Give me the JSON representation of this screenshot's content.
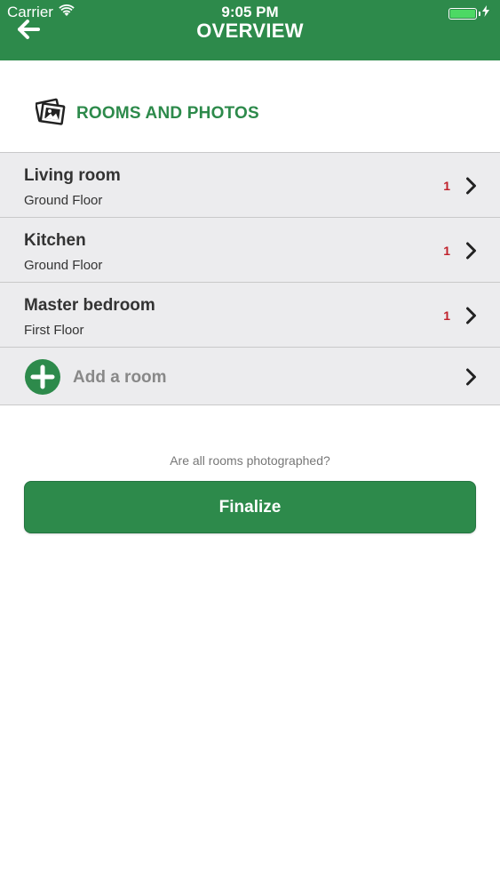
{
  "status_bar": {
    "carrier": "Carrier",
    "time": "9:05 PM"
  },
  "header": {
    "title": "OVERVIEW"
  },
  "section": {
    "title": "ROOMS AND PHOTOS"
  },
  "rooms": [
    {
      "name": "Living room",
      "floor": "Ground Floor",
      "count": "1"
    },
    {
      "name": "Kitchen",
      "floor": "Ground Floor",
      "count": "1"
    },
    {
      "name": "Master bedroom",
      "floor": "First Floor",
      "count": "1"
    }
  ],
  "add_room": {
    "label": "Add a room"
  },
  "finalize": {
    "question": "Are all rooms photographed?",
    "button_label": "Finalize"
  },
  "colors": {
    "brand_green": "#2d8a4b",
    "count_red": "#c0202a",
    "row_background": "#ececee"
  },
  "icons": [
    "wifi-icon",
    "battery-icon",
    "charging-bolt-icon",
    "back-arrow-icon",
    "photos-icon",
    "chevron-right-icon",
    "add-circle-icon"
  ]
}
